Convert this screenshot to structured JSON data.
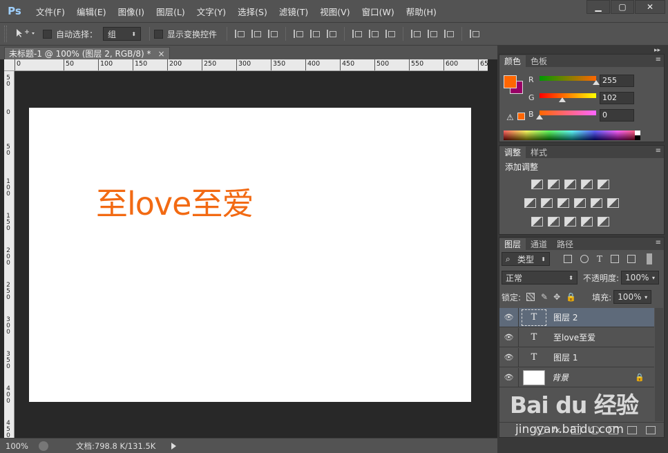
{
  "app": {
    "logo": "Ps"
  },
  "menu": [
    "文件(F)",
    "编辑(E)",
    "图像(I)",
    "图层(L)",
    "文字(Y)",
    "选择(S)",
    "滤镜(T)",
    "视图(V)",
    "窗口(W)",
    "帮助(H)"
  ],
  "window_controls": {
    "minimize": "▁",
    "maximize": "▢",
    "close": "✕"
  },
  "options": {
    "tool_icon": "move-tool-icon",
    "auto_select_label": "自动选择：",
    "auto_select_value": "组",
    "show_transform_label": "显示变换控件"
  },
  "document": {
    "tab_title": "未标题-1 @ 100% (图层 2, RGB/8) *",
    "tab_close": "×",
    "canvas_text": "至love至爱",
    "text_color": "#f26a13"
  },
  "rulers": {
    "top": [
      "0",
      "50",
      "100",
      "150",
      "200",
      "250",
      "300",
      "350",
      "400",
      "450",
      "500",
      "550",
      "600",
      "65"
    ],
    "left": [
      "5\n0",
      "0",
      "5\n0",
      "1\n0\n0",
      "1\n5\n0",
      "2\n0\n0",
      "2\n5\n0",
      "3\n0\n0",
      "3\n5\n0",
      "4\n0\n0",
      "4\n5\n0"
    ]
  },
  "status": {
    "zoom": "100%",
    "doc_info": "文档:798.8 K/131.5K"
  },
  "color_panel": {
    "tabs": [
      "颜色",
      "色板"
    ],
    "foreground": "#ff6600",
    "background": "#990066",
    "channels": [
      {
        "label": "R",
        "value": "255",
        "fraction": 1.0
      },
      {
        "label": "G",
        "value": "102",
        "fraction": 0.4
      },
      {
        "label": "B",
        "value": "0",
        "fraction": 0.0
      }
    ]
  },
  "adjustments_panel": {
    "tabs": [
      "调整",
      "样式"
    ],
    "title": "添加调整"
  },
  "layers_panel": {
    "tabs": [
      "图层",
      "通道",
      "路径"
    ],
    "filter_label": "类型",
    "blend_mode": "正常",
    "opacity_label": "不透明度:",
    "opacity_value": "100%",
    "lock_label": "锁定:",
    "fill_label": "填充:",
    "fill_value": "100%",
    "layers": [
      {
        "name": "图层 2",
        "type": "text",
        "selected": true
      },
      {
        "name": "至love至爱",
        "type": "text",
        "selected": false
      },
      {
        "name": "图层 1",
        "type": "text",
        "selected": false
      },
      {
        "name": "背景",
        "type": "background",
        "selected": false,
        "locked": true
      }
    ],
    "footer_fx": "fx."
  },
  "watermark": {
    "brand": "Bai du 经验",
    "url": "jingyan.baidu.com"
  }
}
